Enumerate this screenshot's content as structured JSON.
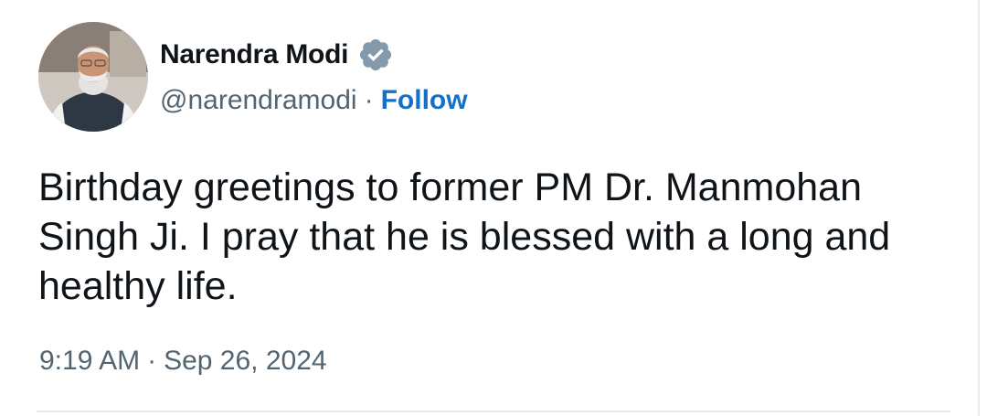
{
  "author": {
    "display_name": "Narendra Modi",
    "handle": "@narendramodi",
    "separator": "·",
    "follow_label": "Follow",
    "verified_icon": "verified-badge-icon"
  },
  "tweet": {
    "text": "Birthday greetings to former PM Dr. Manmohan Singh Ji. I pray that he is blessed with a long and healthy life.",
    "time": "9:19 AM",
    "separator": "·",
    "date": "Sep 26, 2024"
  },
  "colors": {
    "text_primary": "#0f1419",
    "text_secondary": "#536471",
    "follow_link": "#1470c8",
    "verified_badge": "#829aab"
  }
}
